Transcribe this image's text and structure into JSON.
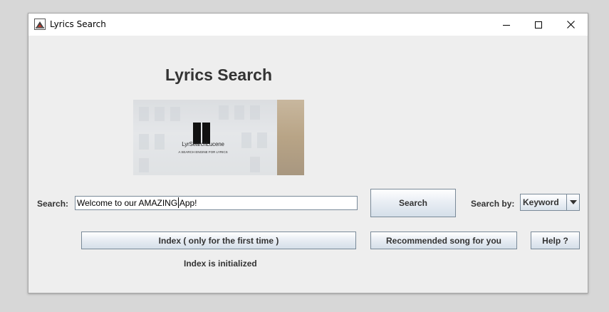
{
  "window": {
    "title": "Lyrics Search",
    "controls": {
      "minimize": "minimize-icon",
      "maximize": "maximize-icon",
      "close": "close-icon"
    }
  },
  "main": {
    "heading": "Lyrics Search",
    "banner": {
      "logo_name": "LyrSearchLucene",
      "logo_tagline": "A SEARCH ENGINE FOR LYRICS"
    },
    "search": {
      "label": "Search:",
      "value": "Welcome to our AMAZING App!",
      "button_label": "Search"
    },
    "search_by": {
      "label": "Search by:",
      "selected": "Keyword"
    },
    "buttons": {
      "index": "Index ( only for the first time )",
      "recommend": "Recommended song for you",
      "help": "Help ?"
    },
    "status": "Index is initialized"
  },
  "colors": {
    "window_bg": "#eeeeee",
    "text": "#333333",
    "button_border": "#7a8a99"
  }
}
